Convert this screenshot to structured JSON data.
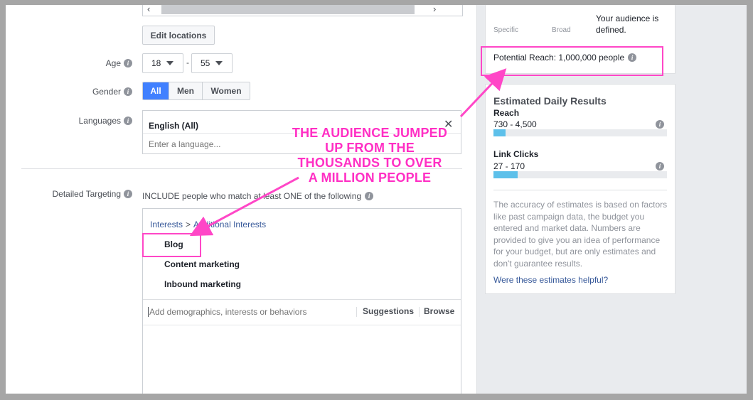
{
  "form": {
    "edit_locations": "Edit locations",
    "age": {
      "label": "Age",
      "min": "18",
      "separator": "-",
      "max": "55"
    },
    "gender": {
      "label": "Gender",
      "options": [
        "All",
        "Men",
        "Women"
      ],
      "selected": "All"
    },
    "languages": {
      "label": "Languages",
      "selected": "English (All)",
      "placeholder": "Enter a language..."
    },
    "detailed_targeting": {
      "label": "Detailed Targeting",
      "include_text": "INCLUDE people who match at least ONE of the following",
      "breadcrumb_part1": "Interests",
      "breadcrumb_sep": ">",
      "breadcrumb_part2": "Additional Interests",
      "items": [
        "Blog",
        "Content marketing",
        "Inbound marketing"
      ],
      "placeholder": "Add demographics, interests or behaviors",
      "suggestions": "Suggestions",
      "browse": "Browse"
    }
  },
  "audience": {
    "specific": "Specific",
    "broad": "Broad",
    "status": "Your audience is defined.",
    "potential_reach": "Potential Reach: 1,000,000 people"
  },
  "estimates": {
    "title": "Estimated Daily Results",
    "reach": {
      "label": "Reach",
      "range": "730 - 4,500",
      "fill_fraction": 0.07
    },
    "link_clicks": {
      "label": "Link Clicks",
      "range": "27 - 170",
      "fill_fraction": 0.14
    },
    "disclaimer": "The accuracy of estimates is based on factors like past campaign data, the budget you entered and market data. Numbers are provided to give you an idea of performance for your budget, but are only estimates and don't guarantee results.",
    "helpful_link": "Were these estimates helpful?"
  },
  "annotation": {
    "line1": "THE AUDIENCE JUMPED",
    "line2": "UP FROM THE",
    "line3": "THOUSANDS TO OVER",
    "line4": "A MILLION PEOPLE"
  },
  "colors": {
    "accent": "#4080ff",
    "annotation": "#ff47c7",
    "bar": "#5dc0ea",
    "link": "#365899"
  }
}
